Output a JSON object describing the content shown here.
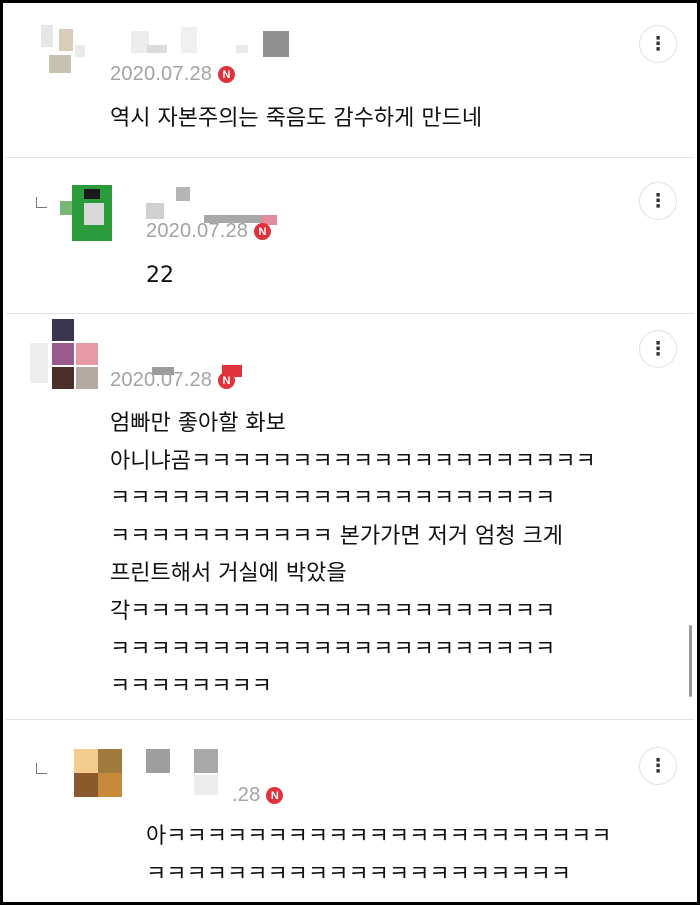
{
  "comments": [
    {
      "date": "2020.07.28",
      "badge": "N",
      "more_icon": "⋮",
      "text": "역시 자본주의는 죽음도 감수하게 만드네"
    },
    {
      "date": "2020.07.28",
      "badge": "N",
      "more_icon": "⋮",
      "text": "22"
    },
    {
      "date": "2020.07.28",
      "badge": "N",
      "more_icon": "⋮",
      "text_lines": [
        "엄빠만 좋아할 화보",
        "아니냐곰ㅋㅋㅋㅋㅋㅋㅋㅋㅋㅋㅋㅋㅋㅋㅋㅋㅋㅋㅋㅋ",
        "ㅋㅋㅋㅋㅋㅋㅋㅋㅋㅋㅋㅋㅋㅋㅋㅋㅋㅋㅋㅋㅋㅋ",
        "ㅋㅋㅋㅋㅋㅋㅋㅋㅋㅋㅋ 본가가면 저거 엄청 크게",
        "프린트해서 거실에 박았을",
        "각ㅋㅋㅋㅋㅋㅋㅋㅋㅋㅋㅋㅋㅋㅋㅋㅋㅋㅋㅋㅋㅋ",
        "ㅋㅋㅋㅋㅋㅋㅋㅋㅋㅋㅋㅋㅋㅋㅋㅋㅋㅋㅋㅋㅋㅋ",
        "ㅋㅋㅋㅋㅋㅋㅋㅋ"
      ]
    },
    {
      "date": ".28",
      "badge": "N",
      "more_icon": "⋮",
      "text_lines": [
        "아ㅋㅋㅋㅋㅋㅋㅋㅋㅋㅋㅋㅋㅋㅋㅋㅋㅋㅋㅋㅋㅋㅋ",
        "ㅋㅋㅋㅋㅋㅋㅋㅋㅋㅋㅋㅋㅋㅋㅋㅋㅋㅋㅋㅋㅋ"
      ]
    }
  ],
  "colors": {
    "date": "#a3a3a3",
    "badge": "#e0323a",
    "divider": "#e2e2e2"
  }
}
